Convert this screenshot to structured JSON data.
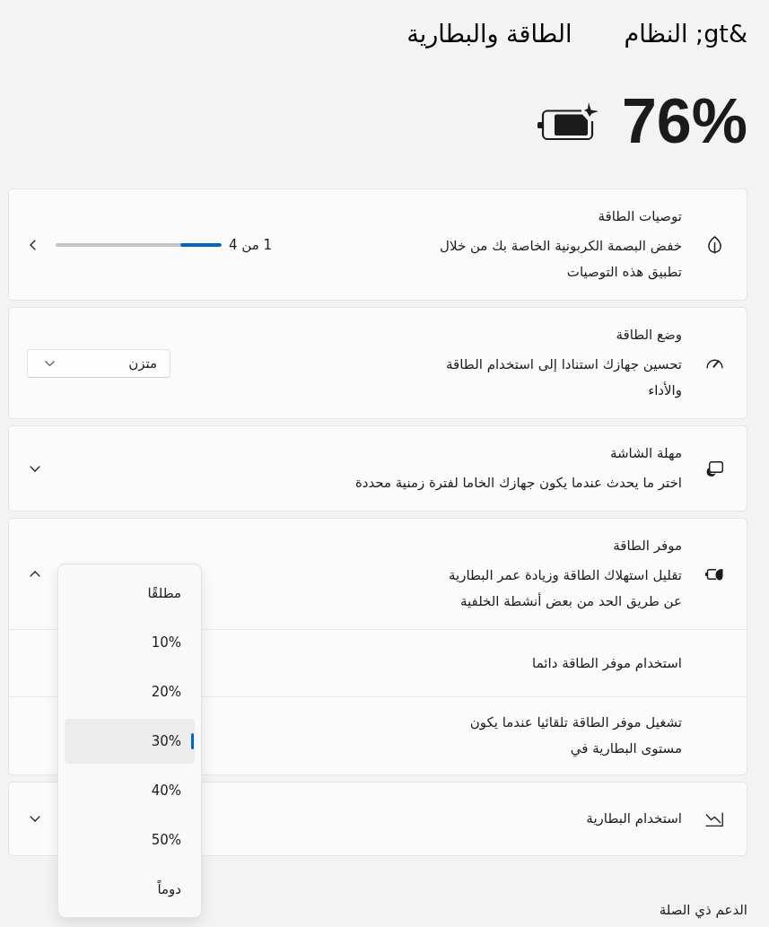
{
  "breadcrumb": {
    "parent": "&gt; النظام",
    "current": "الطاقة والبطارية"
  },
  "battery": {
    "percent": "76%"
  },
  "cards": [
    {
      "kind": "pager",
      "title": "توصيات الطاقة",
      "description": "خفض البصمة الكربونية الخاصة بك من خلال\nتطبيق هذه التوصيات",
      "pager_text": "1 من 4",
      "level": 0.25
    },
    {
      "kind": "dropdown",
      "title": "وضع الطاقة",
      "description": "تحسين جهازك استنادا إلى استخدام الطاقة\nوالأداء",
      "value": "متزن"
    },
    {
      "kind": "expander",
      "title": "مهلة الشاشة",
      "description": "اختر ما يحدث عندما يكون جهازك الخاما لفترة زمنية محددة",
      "expanded": false
    },
    {
      "kind": "expander",
      "title": "موفر الطاقة",
      "description": "تقليل استهلاك الطاقة وزيادة عمر البطارية\nعن طريق الحد من بعض أنشطة الخلفية",
      "expanded": true,
      "rows": [
        {
          "label": "استخدام موفر الطاقة دائما"
        },
        {
          "label": "تشغيل موفر الطاقة تلقائيا عندما يكون\nمستوى البطارية في"
        }
      ]
    },
    {
      "kind": "expander",
      "title": "استخدام البطارية",
      "expanded": false
    }
  ],
  "related": {
    "heading": "الدعم ذي الصلة"
  },
  "threshold_menu": {
    "options": [
      {
        "label": "مطلقًا",
        "selected": false
      },
      {
        "label": "10%",
        "selected": false
      },
      {
        "label": "20%",
        "selected": false
      },
      {
        "label": "30%",
        "selected": true
      },
      {
        "label": "40%",
        "selected": false
      },
      {
        "label": "50%",
        "selected": false
      },
      {
        "label": "دوماً",
        "selected": false
      }
    ]
  }
}
